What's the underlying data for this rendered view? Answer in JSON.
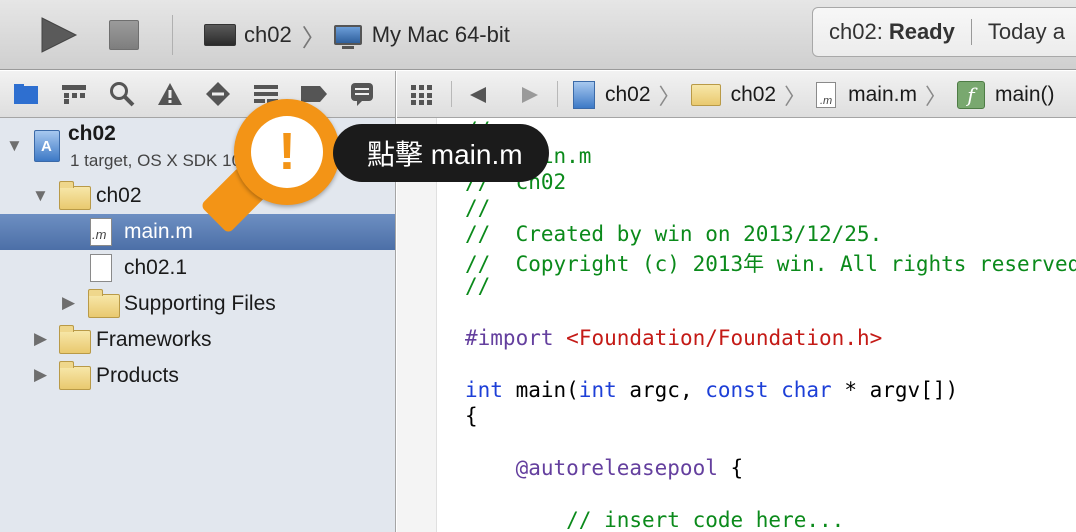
{
  "toolbar": {
    "scheme_project": "ch02",
    "destination": "My Mac 64-bit",
    "activity_status_prefix": "ch02:",
    "activity_status": "Ready",
    "activity_time": "Today a"
  },
  "navigator": {
    "project_name": "ch02",
    "project_subtitle": "1 target, OS X SDK 10.9",
    "items": [
      {
        "label": "ch02"
      },
      {
        "label": "main.m"
      },
      {
        "label": "ch02.1"
      },
      {
        "label": "Supporting Files"
      },
      {
        "label": "Frameworks"
      },
      {
        "label": "Products"
      }
    ]
  },
  "jump_bar": {
    "crumbs": [
      "ch02",
      "ch02",
      "main.m",
      "main()"
    ],
    "file_badge": ".m"
  },
  "editor": {
    "lines": [
      "//",
      "//  main.m",
      "//  ch02",
      "//",
      "//  Created by win on 2013/12/25.",
      "//  Copyright (c) 2013年 win. All rights reserved.",
      "//",
      "#import",
      "<Foundation/Foundation.h>",
      "int",
      " main(",
      "int",
      " argc, ",
      "const",
      " ",
      "char",
      " * argv[])",
      "{",
      "    @autoreleasepool",
      " {",
      "        // insert code here..."
    ]
  },
  "tutorial": {
    "badge": "!",
    "tip": "點擊 main.m",
    "accent_color": "#f39416"
  }
}
